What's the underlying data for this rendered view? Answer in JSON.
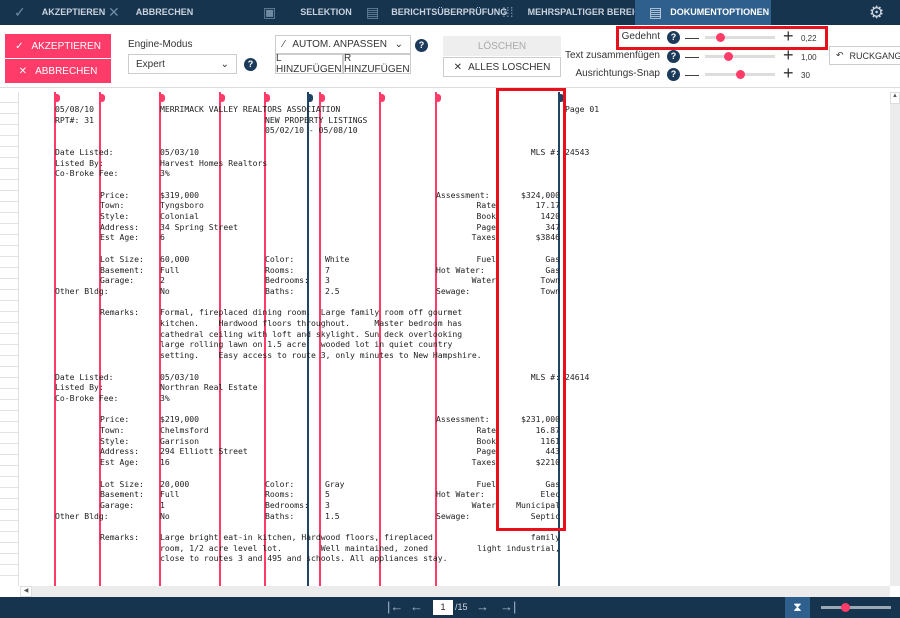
{
  "topbar": {
    "accept": "AKZEPTIEREN",
    "cancel": "ABBRECHEN",
    "selection": "SELEKTION",
    "report_review": "BERICHTSÜBERPRÜFUNG",
    "multicolumn": "MEHRSPALTIGER BEREICH",
    "doc_options": "DOKUMENTOPTIONEN",
    "active_tab": "DOKUMENTOPTIONEN"
  },
  "toolbar": {
    "accept": "AKZEPTIEREN",
    "cancel": "ABBRECHEN",
    "engine_label": "Engine-Modus",
    "engine_value": "Expert",
    "auto_fit": "AUTOM. ANPASSEN",
    "add_l": "L HINZUFÜGEN",
    "add_r": "R HINZUFÜGEN",
    "delete": "LÖSCHEN",
    "delete_all": "ALLES LOSCHEN",
    "undo": "RUCKGANGI",
    "help": "?",
    "sliders": [
      {
        "label": "Gedehnt",
        "value": "0,22",
        "fraction": 0.22
      },
      {
        "label": "Text zusammenfügen",
        "value": "1,00",
        "fraction": 0.33
      },
      {
        "label": "Ausrichtungs-Snap",
        "value": "30",
        "fraction": 0.5
      }
    ]
  },
  "colors": {
    "navy": "#17344f",
    "accent": "#ff3b69",
    "active_tab": "#2f5f8c",
    "highlight": "#e8101c",
    "dark_line": "#1f4466"
  },
  "document": {
    "rows": [
      {
        "a": "05/08/10",
        "c": "MERRIMACK VALLEY REALTORS ASSOCIATION",
        "h": "Page 01"
      },
      {
        "a": "RPT#: 31",
        "d": "NEW PROPERTY LISTINGS"
      },
      {
        "d": "05/02/10 - 05/08/10"
      },
      {},
      {
        "a": "Date Listed:",
        "c": "05/03/10",
        "g": "MLS #:",
        "h": "24543"
      },
      {
        "a": "Listed By:",
        "c": "Harvest Homes Realtors"
      },
      {
        "a": "Co-Broke Fee:",
        "c": "3%"
      },
      {},
      {
        "b": "Price:",
        "c": "$319,000",
        "f": "Assessment:",
        "g": "$324,000"
      },
      {
        "b": "Town:",
        "c": "Tyngsboro",
        "fr": "Rate",
        "g": "17.17"
      },
      {
        "b": "Style:",
        "c": "Colonial",
        "fr": "Book",
        "g": "1420"
      },
      {
        "b": "Address:",
        "c": "34 Spring Street",
        "fr": "Page",
        "g": "347"
      },
      {
        "b": "Est Age:",
        "c": "6",
        "fr": "Taxes",
        "g": "$3846"
      },
      {},
      {
        "b": "Lot Size:",
        "c": "60,000",
        "d": "Color:",
        "e": "White",
        "fr": "Fuel",
        "g": "Gas"
      },
      {
        "b": "Basement:",
        "c": "Full",
        "d": "Rooms:",
        "e": "7",
        "f": "Hot Water:",
        "g": "Gas"
      },
      {
        "b": "Garage:",
        "c": "2",
        "d": "Bedrooms:",
        "e": "3",
        "fr": "Water",
        "g": "Town"
      },
      {
        "a": "Other Bldg:",
        "c": "No",
        "d": "Baths:",
        "e": "2.5",
        "f": "Sewage:",
        "g": "Town"
      },
      {},
      {
        "b": "Remarks:",
        "c": "Formal, fireplaced dining room.  Large family room off gourmet"
      },
      {
        "c": "kitchen.    Hardwood floors throughout.     Master bedroom has"
      },
      {
        "c": "cathedral ceiling with loft and skylight. Sun deck overlooking"
      },
      {
        "c": "large rolling lawn on 1.5 acre   wooded lot in quiet country"
      },
      {
        "c": "setting.    Easy access to route 3, only minutes to New Hampshire."
      },
      {},
      {
        "a": "Date Listed:",
        "c": "05/03/10",
        "g": "MLS #:",
        "h": "24614"
      },
      {
        "a": "Listed By:",
        "c": "Northran Real Estate"
      },
      {
        "a": "Co-Broke Fee:",
        "c": "3%"
      },
      {},
      {
        "b": "Price:",
        "c": "$219,000",
        "f": "Assessment:",
        "g": "$231,000"
      },
      {
        "b": "Town:",
        "c": "Chelmsford",
        "fr": "Rate",
        "g": "16.87"
      },
      {
        "b": "Style:",
        "c": "Garrison",
        "fr": "Book",
        "g": "1161"
      },
      {
        "b": "Address:",
        "c": "294 Elliott Street",
        "fr": "Page",
        "g": "443"
      },
      {
        "b": "Est Age:",
        "c": "16",
        "fr": "Taxes",
        "g": "$2210"
      },
      {},
      {
        "b": "Lot Size:",
        "c": "20,000",
        "d": "Color:",
        "e": "Gray",
        "fr": "Fuel",
        "g": "Gas"
      },
      {
        "b": "Basement:",
        "c": "Full",
        "d": "Rooms:",
        "e": "5",
        "f": "Hot Water:",
        "g": "Elec"
      },
      {
        "b": "Garage:",
        "c": "1",
        "d": "Bedrooms:",
        "e": "3",
        "fr": "Water",
        "g": "Municipal"
      },
      {
        "a": "Other Bldg:",
        "c": "No",
        "d": "Baths:",
        "e": "1.5",
        "f": "Sewage:",
        "g": "Septic"
      },
      {},
      {
        "b": "Remarks:",
        "c": "Large bright eat-in kitchen, Hardwood floors, fireplaced",
        "g": "family"
      },
      {
        "c": "room, 1/2 acre level lot.        Well maintained, zoned",
        "g": "light industrial,"
      },
      {
        "c": "close to routes 3 and 495 and schools. All appliances stay."
      }
    ]
  },
  "pager": {
    "current": "1",
    "total": "/15"
  }
}
